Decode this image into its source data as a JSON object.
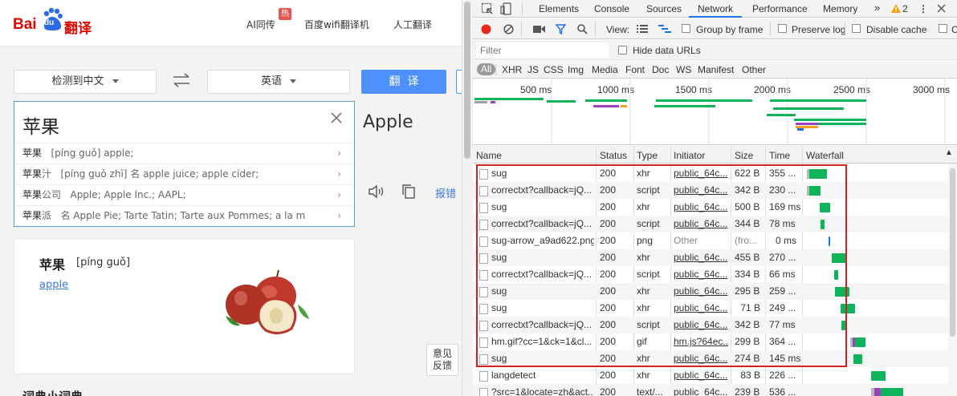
{
  "translator": {
    "logo": {
      "bai": "Bai",
      "du": "du",
      "fanyi": "翻译"
    },
    "nav": [
      {
        "label": "AI同传",
        "badge": "热"
      },
      {
        "label": "百度wifi翻译机"
      },
      {
        "label": "人工翻译"
      }
    ],
    "source_lang": "检测到中文",
    "target_lang": "英语",
    "translate_button": "翻  译",
    "input_text": "苹果",
    "result_text": "Apple",
    "suggestions": [
      {
        "word": "苹果",
        "rest": "",
        "detail": "[píng guǒ] apple;"
      },
      {
        "word": "苹果",
        "rest": "汁",
        "detail": "[píng guǒ zhī] 名 apple juice; apple cider;"
      },
      {
        "word": "苹果",
        "rest": "公司",
        "detail": "Apple; Apple Inc.; AAPL;"
      },
      {
        "word": "苹果",
        "rest": "派",
        "detail": "名 Apple Pie; Tarte Tatin; Tarte aux Pommes; a la m"
      }
    ],
    "error_report_label": "报错",
    "card": {
      "word": "苹果",
      "pinyin": "[píng guǒ]",
      "link": "apple"
    },
    "feedback": [
      "意见",
      "反馈"
    ],
    "bottom_partial_heading": "词典小词典"
  },
  "devtools": {
    "tabs": [
      "Elements",
      "Console",
      "Sources",
      "Network",
      "Performance",
      "Memory"
    ],
    "active_tab": "Network",
    "warning_count": "2",
    "toolbar": {
      "view_label": "View:",
      "group_by_frame": "Group by frame",
      "preserve_log": "Preserve log",
      "disable_cache": "Disable cache",
      "partial": "C"
    },
    "filter": {
      "placeholder": "Filter",
      "hide_data_urls": "Hide data URLs"
    },
    "types": [
      "All",
      "XHR",
      "JS",
      "CSS",
      "Img",
      "Media",
      "Font",
      "Doc",
      "WS",
      "Manifest",
      "Other"
    ],
    "timeline_ticks": [
      "500 ms",
      "1000 ms",
      "1500 ms",
      "2000 ms",
      "2500 ms",
      "3000 ms"
    ],
    "columns": [
      "Name",
      "Status",
      "Type",
      "Initiator",
      "Size",
      "Time",
      "Waterfall"
    ],
    "rows": [
      {
        "name": "sug",
        "status": "200",
        "type": "xhr",
        "initiator": "public_64c...",
        "size": "622 B",
        "time": "355 ..."
      },
      {
        "name": "correctxt?callback=jQ...",
        "status": "200",
        "type": "script",
        "initiator": "public_64c...",
        "size": "342 B",
        "time": "230 ..."
      },
      {
        "name": "sug",
        "status": "200",
        "type": "xhr",
        "initiator": "public_64c...",
        "size": "500 B",
        "time": "169 ms"
      },
      {
        "name": "correctxt?callback=jQ...",
        "status": "200",
        "type": "script",
        "initiator": "public_64c...",
        "size": "344 B",
        "time": "78 ms"
      },
      {
        "name": "sug-arrow_a9ad622.png",
        "status": "200",
        "type": "png",
        "initiator": "Other",
        "size": "(fro...",
        "time": "0 ms"
      },
      {
        "name": "sug",
        "status": "200",
        "type": "xhr",
        "initiator": "public_64c...",
        "size": "455 B",
        "time": "270 ..."
      },
      {
        "name": "correctxt?callback=jQ...",
        "status": "200",
        "type": "script",
        "initiator": "public_64c...",
        "size": "334 B",
        "time": "66 ms"
      },
      {
        "name": "sug",
        "status": "200",
        "type": "xhr",
        "initiator": "public_64c...",
        "size": "295 B",
        "time": "259 ..."
      },
      {
        "name": "sug",
        "status": "200",
        "type": "xhr",
        "initiator": "public_64c...",
        "size": "71 B",
        "time": "249 ..."
      },
      {
        "name": "correctxt?callback=jQ...",
        "status": "200",
        "type": "script",
        "initiator": "public_64c...",
        "size": "342 B",
        "time": "77 ms"
      },
      {
        "name": "hm.gif?cc=1&ck=1&cl...",
        "status": "200",
        "type": "gif",
        "initiator": "hm.js?64ec...",
        "size": "299 B",
        "time": "364 ..."
      },
      {
        "name": "sug",
        "status": "200",
        "type": "xhr",
        "initiator": "public_64c...",
        "size": "274 B",
        "time": "145 ms"
      },
      {
        "name": "langdetect",
        "status": "200",
        "type": "xhr",
        "initiator": "public_64c...",
        "size": "83 B",
        "time": "226 ..."
      },
      {
        "name": "?src=1&locate=zh&act...",
        "status": "200",
        "type": "text/...",
        "initiator": "public_64c...",
        "size": "239 B",
        "time": "536 ..."
      }
    ],
    "colors": {
      "accent": "#1a73e8",
      "waterfall_green": "#0eb35a",
      "highlight_box": "#d32020",
      "warning": "#f5a000",
      "record": "#e8271e"
    }
  }
}
